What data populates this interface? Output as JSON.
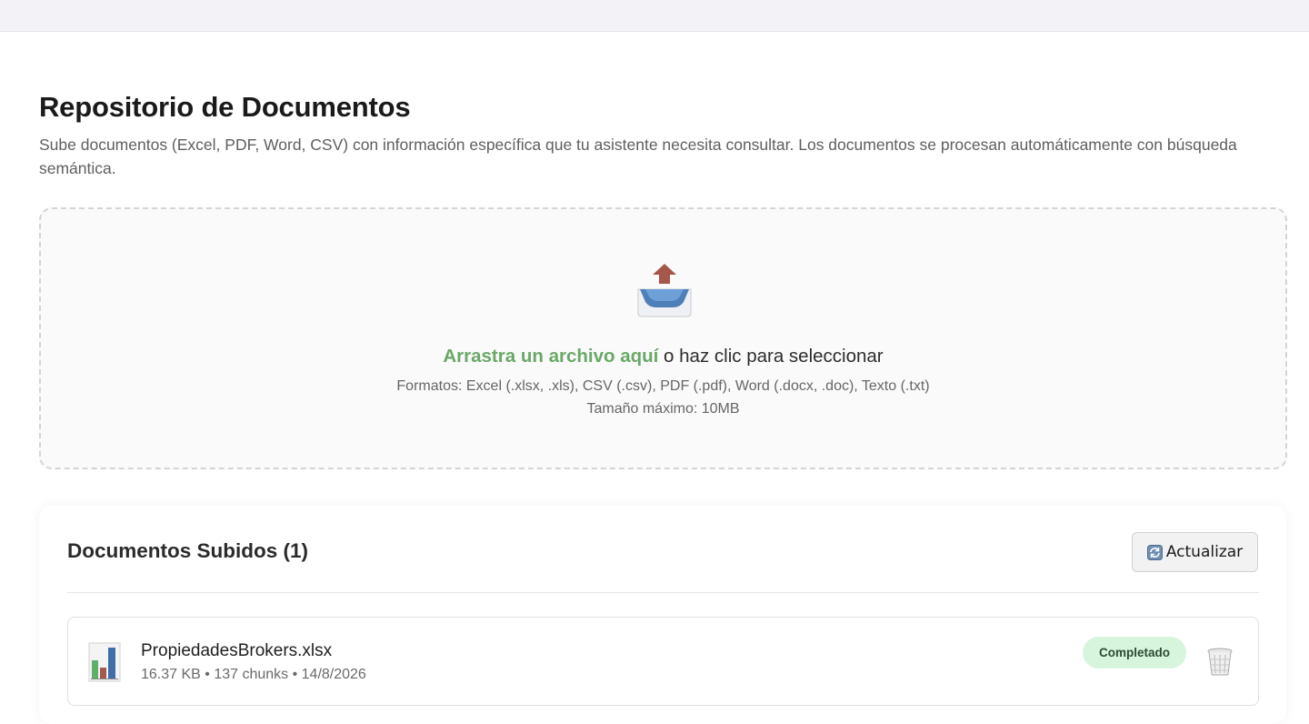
{
  "page": {
    "title": "Repositorio de Documentos",
    "description": "Sube documentos (Excel, PDF, Word, CSV) con información específica que tu asistente necesita consultar. Los documentos se procesan automáticamente con búsqueda semántica."
  },
  "dropzone": {
    "icon": "inbox-upload-icon",
    "accent_text": "Arrastra un archivo aquí",
    "rest_text": " o haz clic para seleccionar",
    "formats": "Formatos: Excel (.xlsx, .xls), CSV (.csv), PDF (.pdf), Word (.docx, .doc), Texto (.txt)",
    "max_size": "Tamaño máximo: 10MB",
    "accent_color": "#6aa867"
  },
  "documents": {
    "title": "Documentos Subidos (1)",
    "refresh_label": "Actualizar",
    "refresh_icon": "refresh-icon",
    "items": [
      {
        "icon": "spreadsheet-icon",
        "name": "PropiedadesBrokers.xlsx",
        "meta": "16.37 KB • 137 chunks • 14/8/2026",
        "status": "Completado",
        "status_color": "#d7f5dc",
        "delete_icon": "trash-icon"
      }
    ]
  }
}
